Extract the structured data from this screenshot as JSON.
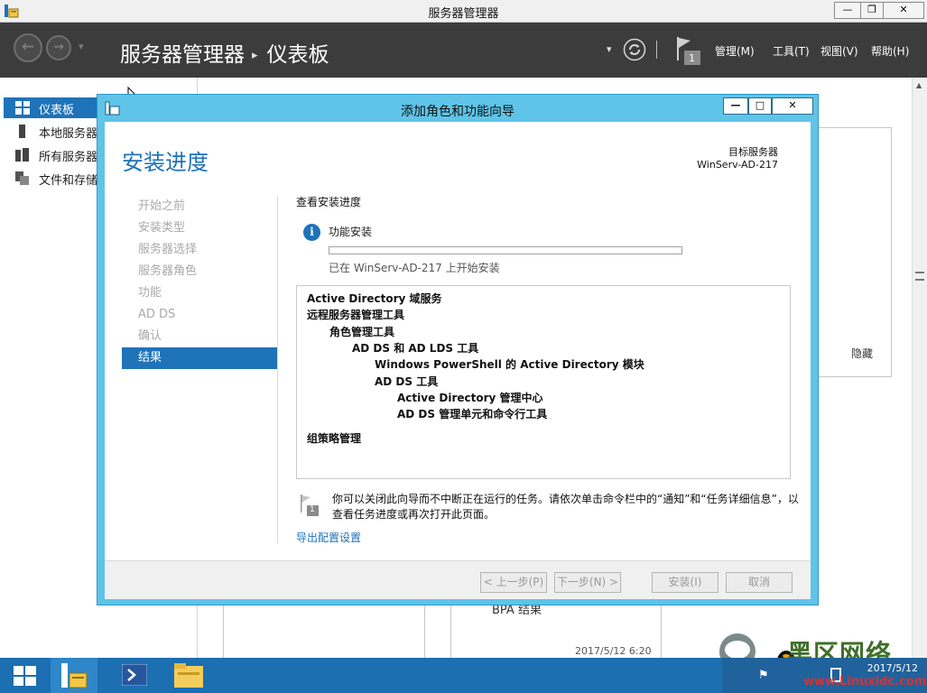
{
  "window": {
    "title": "服务器管理器",
    "min": "—",
    "max": "❐",
    "close": "✕"
  },
  "header": {
    "app_name": "服务器管理器",
    "separator": "▸",
    "page": "仪表板",
    "dropdown": "▾",
    "flag_count": "1",
    "menus": [
      "管理(M)",
      "工具(T)",
      "视图(V)",
      "帮助(H)"
    ]
  },
  "leftnav": {
    "items": [
      {
        "label": "仪表板",
        "icon": "dashboard-icon"
      },
      {
        "label": "本地服务器",
        "icon": "server-icon"
      },
      {
        "label": "所有服务器",
        "icon": "servers-icon"
      },
      {
        "label": "文件和存储服务",
        "icon": "storage-icon"
      }
    ]
  },
  "background": {
    "hide_link": "隐藏",
    "bpa_label": "BPA 结果",
    "timestamp": "2017/5/12 6:20"
  },
  "dialog": {
    "title": "添加角色和功能向导",
    "min": "—",
    "max": "□",
    "close": "✕",
    "heading": "安装进度",
    "target_label": "目标服务器",
    "target_name": "WinServ-AD-217",
    "steps": [
      "开始之前",
      "安装类型",
      "服务器选择",
      "服务器角色",
      "功能",
      "AD DS",
      "确认",
      "结果"
    ],
    "active_step": 7,
    "sub_title": "查看安装进度",
    "feature_install_label": "功能安装",
    "progress_fraction": 0.0,
    "progress_status": "已在 WinServ-AD-217 上开始安装",
    "features": [
      {
        "text": "Active Directory 域服务",
        "level": 0
      },
      {
        "text": "远程服务器管理工具",
        "level": 0
      },
      {
        "text": "角色管理工具",
        "level": 1
      },
      {
        "text": "AD DS 和 AD LDS 工具",
        "level": 2
      },
      {
        "text": "Windows PowerShell 的 Active Directory 模块",
        "level": 3
      },
      {
        "text": "AD DS 工具",
        "level": 3
      },
      {
        "text": "Active Directory 管理中心",
        "level": 4
      },
      {
        "text": "AD DS 管理单元和命令行工具",
        "level": 4
      },
      {
        "text": "组策略管理",
        "level": 0
      }
    ],
    "flag_badge": "1",
    "note": "你可以关闭此向导而不中断正在运行的任务。请依次单击命令栏中的“通知”和“任务详细信息”，以查看任务进度或再次打开此页面。",
    "export_link": "导出配置设置",
    "buttons": {
      "prev": "< 上一步(P)",
      "next": "下一步(N) >",
      "install": "安装(I)",
      "cancel": "取消"
    }
  },
  "taskbar": {
    "start_icon": "windows-start-icon"
  },
  "tray": {
    "time": "",
    "date": "2017/5/12"
  },
  "watermark": {
    "main": "黑区网络",
    "sub": "www.Linuxidc.com"
  },
  "colors": {
    "accent": "#1e73b9",
    "dialog_frame": "#5fc4e8",
    "header": "#3c3c3c",
    "taskbar": "#1c6fb0"
  }
}
